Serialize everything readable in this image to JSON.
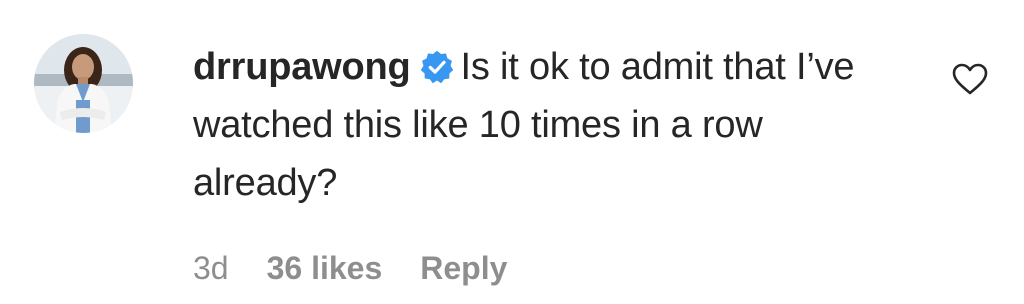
{
  "comment": {
    "username": "drrupawong",
    "text": "Is it ok to admit that I’ve watched this like 10 times in a row already?",
    "timestamp": "3d",
    "likes": "36 likes",
    "reply_label": "Reply",
    "verified_icon": "verified-badge-icon",
    "like_icon": "heart-outline-icon",
    "colors": {
      "text": "#262626",
      "muted": "#8e8e8e",
      "verified": "#3897f0"
    }
  }
}
